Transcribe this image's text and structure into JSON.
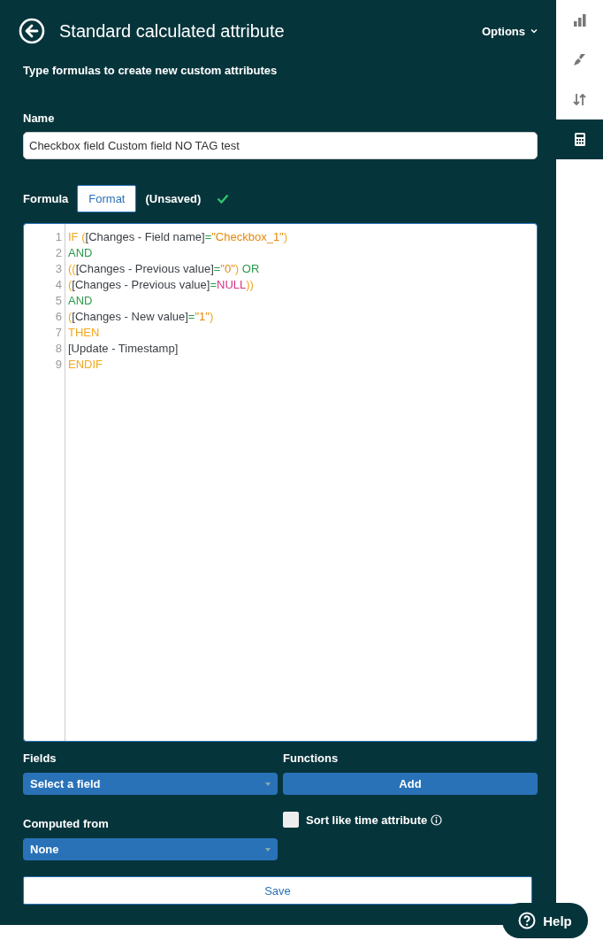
{
  "header": {
    "title": "Standard calculated attribute",
    "options": "Options"
  },
  "subtitle": "Type formulas to create new custom attributes",
  "name_field": {
    "label": "Name",
    "value": "Checkbox field Custom field NO TAG test"
  },
  "formula": {
    "label": "Formula",
    "format_button": "Format",
    "status": "(Unsaved)",
    "valid": true
  },
  "editor": {
    "lines": [
      {
        "number": "1",
        "tokens": [
          {
            "kind": "keyword",
            "text": "IF "
          },
          {
            "kind": "paren",
            "text": "("
          },
          {
            "kind": "field",
            "text": "[Changes - Field name]"
          },
          {
            "kind": "op",
            "text": "="
          },
          {
            "kind": "string",
            "text": "\"Checkbox_1\""
          },
          {
            "kind": "paren",
            "text": ")"
          }
        ]
      },
      {
        "number": "2",
        "tokens": [
          {
            "kind": "op",
            "text": "AND"
          }
        ]
      },
      {
        "number": "3",
        "tokens": [
          {
            "kind": "paren",
            "text": "(("
          },
          {
            "kind": "field",
            "text": "[Changes - Previous value]"
          },
          {
            "kind": "op",
            "text": "="
          },
          {
            "kind": "string",
            "text": "\"0\""
          },
          {
            "kind": "paren",
            "text": ")"
          },
          {
            "kind": "op",
            "text": " OR"
          }
        ]
      },
      {
        "number": "4",
        "tokens": [
          {
            "kind": "paren",
            "text": "("
          },
          {
            "kind": "field",
            "text": "[Changes - Previous value]"
          },
          {
            "kind": "op",
            "text": "="
          },
          {
            "kind": "null",
            "text": "NULL"
          },
          {
            "kind": "paren",
            "text": "))"
          }
        ]
      },
      {
        "number": "5",
        "tokens": [
          {
            "kind": "op",
            "text": "AND"
          }
        ]
      },
      {
        "number": "6",
        "tokens": [
          {
            "kind": "paren",
            "text": "("
          },
          {
            "kind": "field",
            "text": "[Changes - New value]"
          },
          {
            "kind": "op",
            "text": "="
          },
          {
            "kind": "string",
            "text": "\"1\""
          },
          {
            "kind": "paren",
            "text": ")"
          }
        ]
      },
      {
        "number": "7",
        "tokens": [
          {
            "kind": "keyword",
            "text": "THEN"
          }
        ]
      },
      {
        "number": "8",
        "tokens": [
          {
            "kind": "field",
            "text": "[Update - Timestamp]"
          }
        ]
      },
      {
        "number": "9",
        "tokens": [
          {
            "kind": "keyword",
            "text": "ENDIF"
          }
        ]
      }
    ]
  },
  "fields": {
    "label": "Fields",
    "value": "Select a field"
  },
  "functions": {
    "label": "Functions",
    "button": "Add"
  },
  "computed_from": {
    "label": "Computed from",
    "value": "None"
  },
  "sort_like_time": {
    "label": "Sort like time attribute",
    "checked": false
  },
  "save_button": "Save",
  "help_button": "Help",
  "sidebar": {
    "items": [
      {
        "kind": "chart",
        "selected": false
      },
      {
        "kind": "brush",
        "selected": false
      },
      {
        "kind": "sort",
        "selected": false
      },
      {
        "kind": "calculator",
        "selected": true
      }
    ]
  }
}
